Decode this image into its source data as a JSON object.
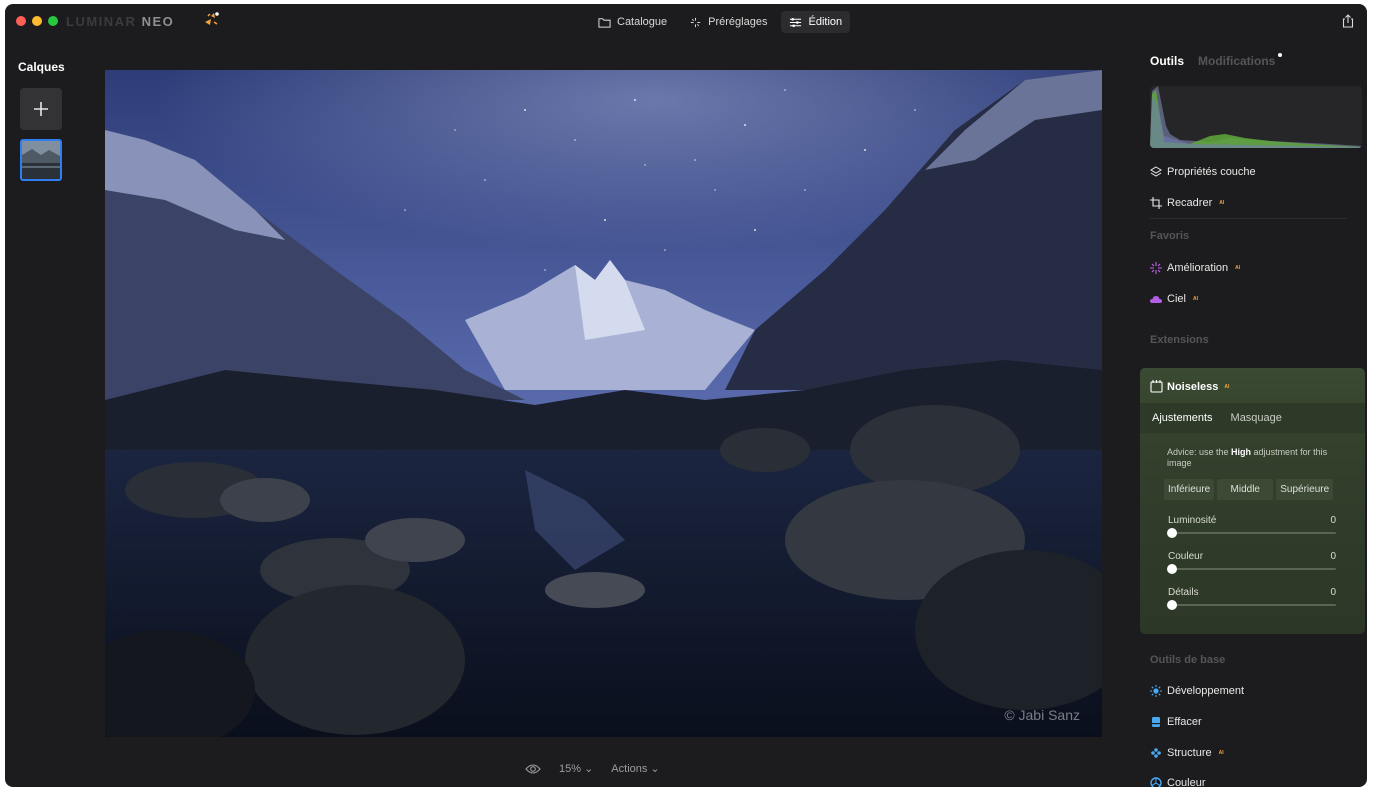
{
  "app": {
    "logo_prefix": "LUMINAR",
    "logo_suffix": "NEO"
  },
  "nav": {
    "catalogue": "Catalogue",
    "presets": "Préréglages",
    "edition": "Édition",
    "active": "edition"
  },
  "left_panel": {
    "title": "Calques",
    "add_label": "+"
  },
  "photo": {
    "copyright": "© Jabi Sanz"
  },
  "bottom_bar": {
    "zoom": "15% ⌄",
    "actions": "Actions ⌄"
  },
  "right_panel": {
    "tabs": {
      "tools": "Outils",
      "modifications": "Modifications"
    },
    "layer_properties": "Propriétés couche",
    "crop": "Recadrer",
    "favorites_heading": "Favoris",
    "enhance": "Amélioration",
    "sky": "Ciel",
    "extensions_heading": "Extensions",
    "noiseless": {
      "title": "Noiseless",
      "tabs": {
        "adjustments": "Ajustements",
        "masking": "Masquage"
      },
      "advice_prefix": "Advice: use the ",
      "advice_bold": "High",
      "advice_suffix": " adjustment for this image",
      "levels": [
        "Inférieure",
        "Middle",
        "Supérieure"
      ],
      "sliders": [
        {
          "label": "Luminosité",
          "value": "0",
          "level": 0
        },
        {
          "label": "Couleur",
          "value": "0",
          "level": 0
        },
        {
          "label": "Détails",
          "value": "0",
          "level": 0
        }
      ]
    },
    "basic_heading": "Outils de base",
    "basic_tools": [
      "Développement",
      "Effacer",
      "Structure",
      "Couleur"
    ],
    "ai_badge": "AI"
  },
  "colors": {
    "accent_blue": "#2f7ff0",
    "ai_orange": "#f2a43a",
    "noiseless_green": "#3b4a33",
    "histogram_green": "#5fa83a"
  }
}
